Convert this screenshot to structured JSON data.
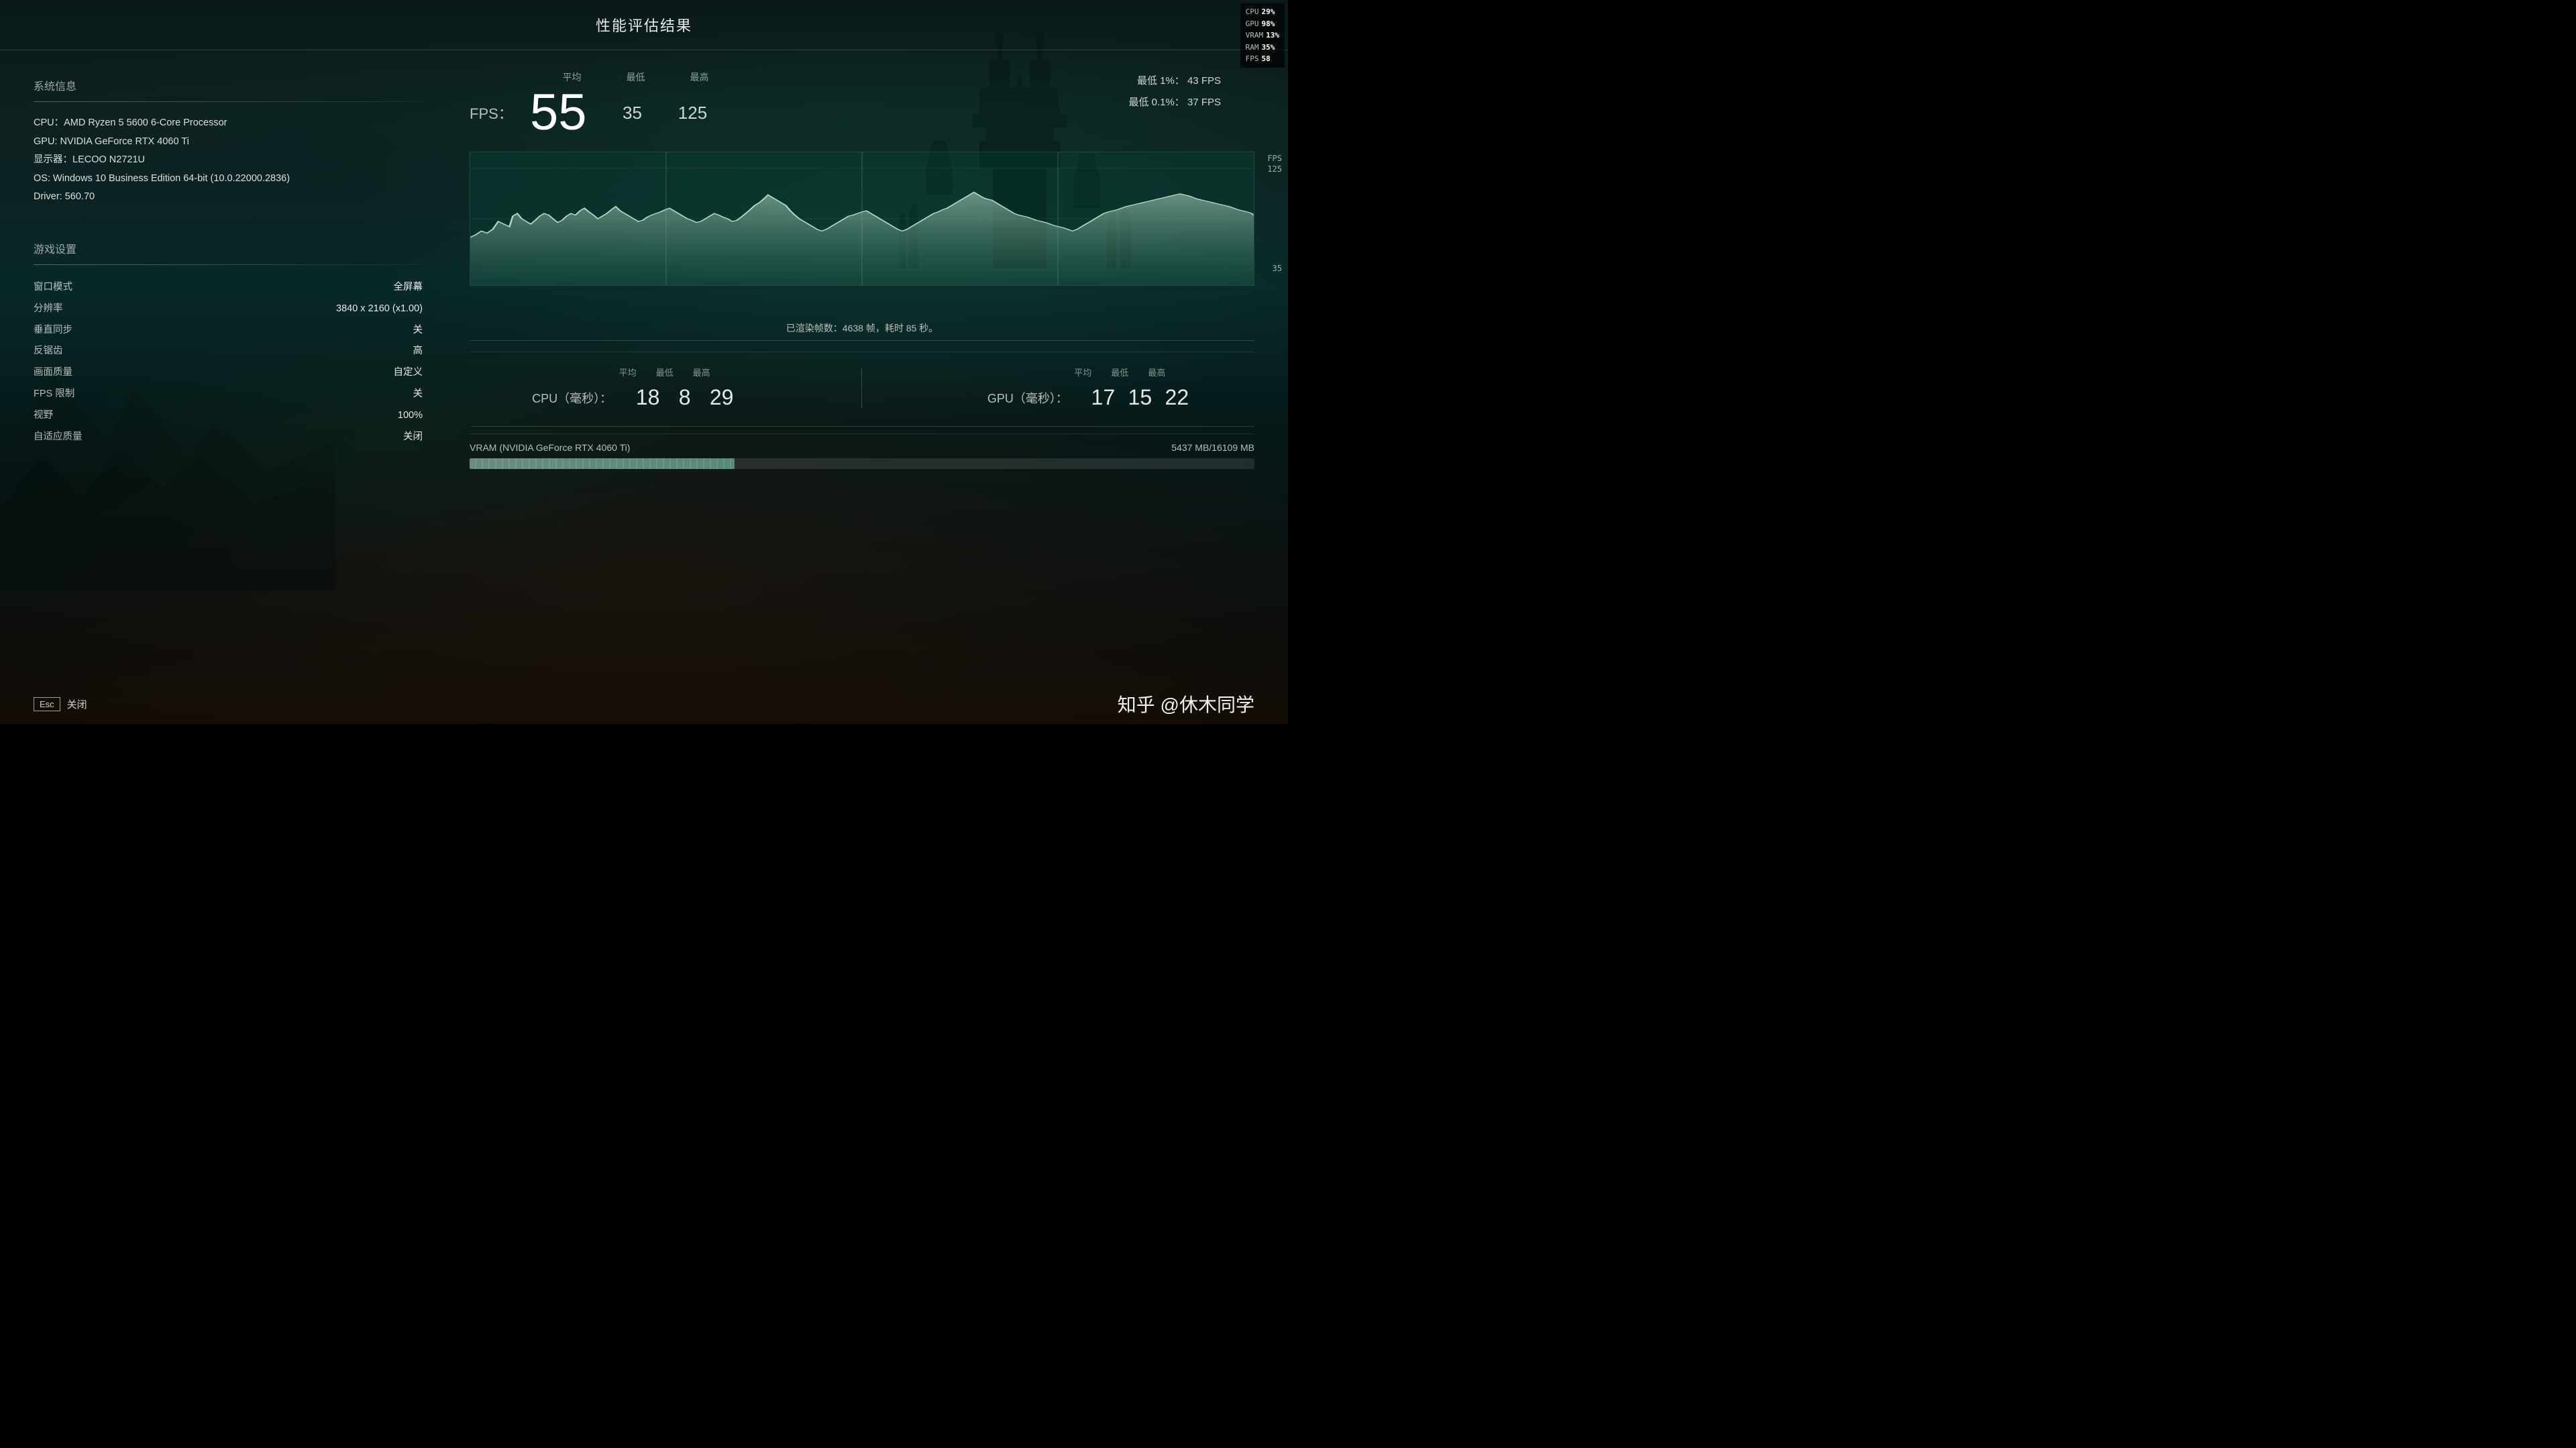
{
  "page": {
    "title": "性能评估结果"
  },
  "hud": {
    "cpu_label": "CPU",
    "cpu_value": "29%",
    "gpu_label": "GPU",
    "gpu_value": "98%",
    "vram_label": "VRAM",
    "vram_value": "13%",
    "ram_label": "RAM",
    "ram_value": "35%",
    "fps_label": "FPS",
    "fps_value": "58"
  },
  "system_info": {
    "section_title": "系统信息",
    "cpu": "CPU：AMD Ryzen 5 5600 6-Core Processor",
    "gpu": "GPU: NVIDIA GeForce RTX 4060 Ti",
    "display": "显示器：LECOO N2721U",
    "os": "OS: Windows 10 Business Edition 64-bit (10.0.22000.2836)",
    "driver": "Driver: 560.70"
  },
  "game_settings": {
    "section_title": "游戏设置",
    "settings": [
      {
        "label": "窗口模式",
        "value": "全屏幕"
      },
      {
        "label": "分辨率",
        "value": "3840 x 2160 (x1.00)"
      },
      {
        "label": "垂直同步",
        "value": "关"
      },
      {
        "label": "反锯齿",
        "value": "高"
      },
      {
        "label": "画面质量",
        "value": "自定义"
      },
      {
        "label": "FPS 限制",
        "value": "关"
      },
      {
        "label": "视野",
        "value": "100%"
      },
      {
        "label": "自适应质量",
        "value": "关闭"
      }
    ]
  },
  "fps_display": {
    "label": "FPS：",
    "avg_header": "平均",
    "min_header": "最低",
    "max_header": "最高",
    "avg_value": "55",
    "min_value": "35",
    "max_value": "125",
    "percentile_1_label": "最低 1%：",
    "percentile_1_value": "43 FPS",
    "percentile_01_label": "最低 0.1%：",
    "percentile_01_value": "37 FPS",
    "chart_fps_label": "FPS",
    "chart_y_top": "125",
    "chart_y_bottom": "35"
  },
  "rendered_frames": {
    "text": "已渲染帧数：4638 帧，耗时 85 秒。"
  },
  "cpu_timing": {
    "label": "CPU（毫秒）：",
    "avg_header": "平均",
    "min_header": "最低",
    "max_header": "最高",
    "avg_value": "18",
    "min_value": "8",
    "max_value": "29"
  },
  "gpu_timing": {
    "label": "GPU（毫秒）：",
    "avg_header": "平均",
    "min_header": "最低",
    "max_header": "最高",
    "avg_value": "17",
    "min_value": "15",
    "max_value": "22"
  },
  "vram": {
    "label": "VRAM (NVIDIA GeForce RTX 4060 Ti)",
    "used": "5437 MB",
    "total": "16109 MB",
    "display": "5437 MB/16109 MB",
    "fill_percent": 33.75
  },
  "bottom": {
    "esc_label": "Esc",
    "close_label": "关闭",
    "watermark": "知乎 @休木同学"
  }
}
